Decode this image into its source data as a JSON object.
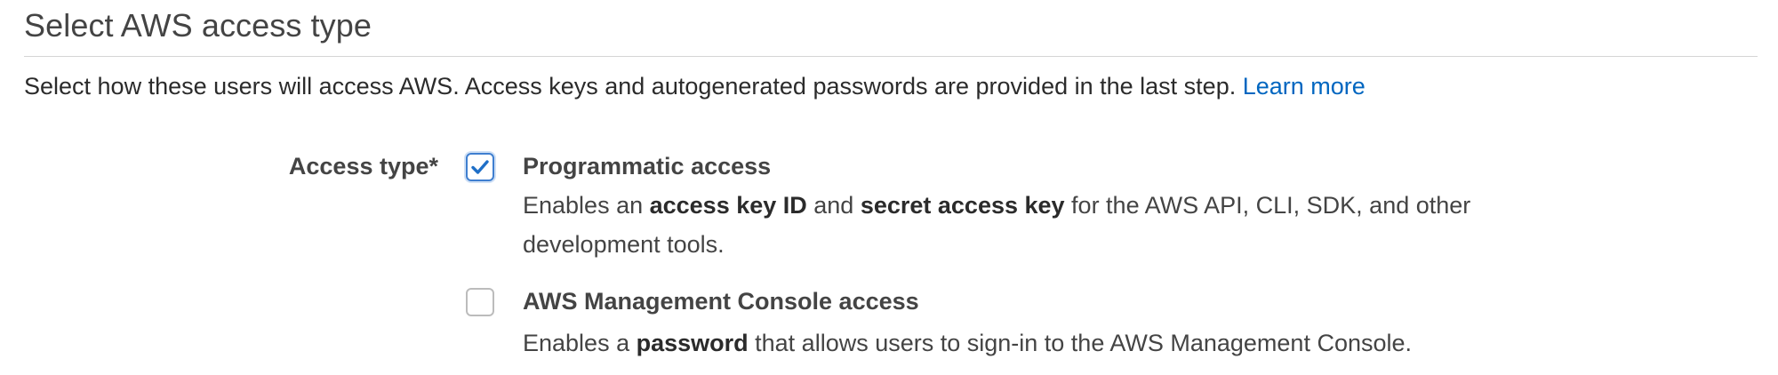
{
  "section": {
    "title": "Select AWS access type"
  },
  "intro": {
    "text": "Select how these users will access AWS. Access keys and autogenerated passwords are provided in the last step.",
    "link_label": "Learn more"
  },
  "access_type": {
    "label": "Access type*",
    "options": [
      {
        "title": "Programmatic access",
        "checked": true,
        "desc_part1": "Enables an ",
        "desc_bold1": "access key ID",
        "desc_part2": " and ",
        "desc_bold2": "secret access key",
        "desc_part3": " for the AWS API, CLI, SDK, and other development tools."
      },
      {
        "title": "AWS Management Console access",
        "checked": false,
        "desc_part1": "Enables a ",
        "desc_bold1": "password",
        "desc_part2": " that allows users to sign-in to the AWS Management Console."
      }
    ]
  },
  "colors": {
    "link": "#0066c0",
    "checkbox_accent": "#3f7fd0"
  }
}
